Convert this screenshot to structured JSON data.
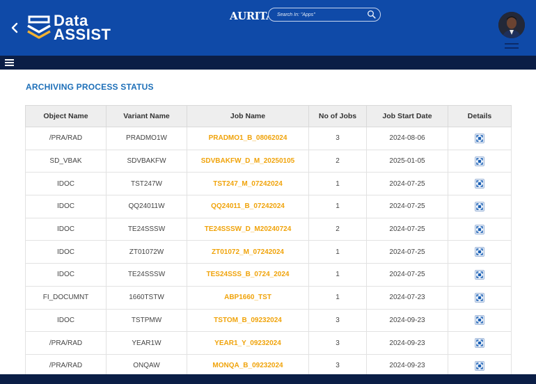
{
  "header": {
    "logo_line1": "Data",
    "logo_line2": "ASSIST",
    "brand": "AURITAS",
    "search_placeholder": "Search In: \"Apps\""
  },
  "page": {
    "title": "ARCHIVING PROCESS STATUS"
  },
  "table": {
    "columns": [
      "Object Name",
      "Variant Name",
      "Job Name",
      "No of Jobs",
      "Job Start Date",
      "Details"
    ],
    "rows": [
      {
        "object": "/PRA/RAD",
        "variant": "PRADMO1W",
        "job": "PRADMO1_B_08062024",
        "count": "3",
        "date": "2024-08-06"
      },
      {
        "object": "SD_VBAK",
        "variant": "SDVBAKFW",
        "job": "SDVBAKFW_D_M_20250105",
        "count": "2",
        "date": "2025-01-05"
      },
      {
        "object": "IDOC",
        "variant": "TST247W",
        "job": "TST247_M_07242024",
        "count": "1",
        "date": "2024-07-25"
      },
      {
        "object": "IDOC",
        "variant": "QQ24011W",
        "job": "QQ24011_B_07242024",
        "count": "1",
        "date": "2024-07-25"
      },
      {
        "object": "IDOC",
        "variant": "TE24SSSW",
        "job": "TE24SSSW_D_M20240724",
        "count": "2",
        "date": "2024-07-25"
      },
      {
        "object": "IDOC",
        "variant": "ZT01072W",
        "job": "ZT01072_M_07242024",
        "count": "1",
        "date": "2024-07-25"
      },
      {
        "object": "IDOC",
        "variant": "TE24SSSW",
        "job": "TES24SSS_B_0724_2024",
        "count": "1",
        "date": "2024-07-25"
      },
      {
        "object": "FI_DOCUMNT",
        "variant": "1660TSTW",
        "job": "ABP1660_TST",
        "count": "1",
        "date": "2024-07-23"
      },
      {
        "object": "IDOC",
        "variant": "TSTPMW",
        "job": "TSTOM_B_09232024",
        "count": "3",
        "date": "2024-09-23"
      },
      {
        "object": "/PRA/RAD",
        "variant": "YEAR1W",
        "job": "YEAR1_Y_09232024",
        "count": "3",
        "date": "2024-09-23"
      },
      {
        "object": "/PRA/RAD",
        "variant": "ONQAW",
        "job": "MONQA_B_09232024",
        "count": "3",
        "date": "2024-09-23"
      }
    ]
  },
  "colors": {
    "header_bg": "#0f4aa8",
    "nav_bg": "#0b1e46",
    "title": "#1d6fb8",
    "job_link": "#f0a30a"
  },
  "icons": {
    "back": "chevron-left-icon",
    "search": "search-icon",
    "menu": "hamburger-icon",
    "details": "expand-icon"
  }
}
